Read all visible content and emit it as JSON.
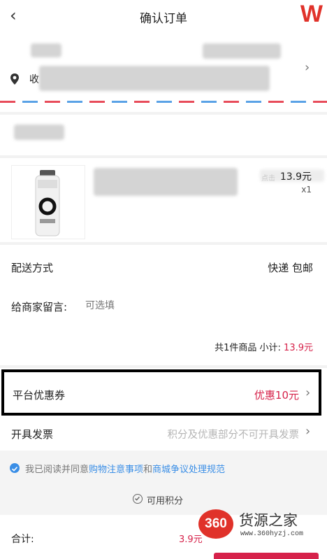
{
  "header": {
    "back_icon": "chevron-left-icon",
    "title": "确认订单",
    "brand_glyph": "W"
  },
  "address": {
    "prefix": "收",
    "pin_icon": "location-pin-icon"
  },
  "product": {
    "price": "13.9元",
    "quantity": "x1",
    "badge": "点击"
  },
  "delivery": {
    "label": "配送方式",
    "value": "快递 包邮"
  },
  "message": {
    "label": "给商家留言:",
    "placeholder": "可选填"
  },
  "subtotal": {
    "text": "共1件商品 小计:",
    "amount": "13.9元"
  },
  "coupon": {
    "label": "平台优惠券",
    "value": "优惠10元"
  },
  "invoice": {
    "label": "开具发票",
    "note": "积分及优惠部分不可开具发票"
  },
  "agreement": {
    "prefix": "我已阅读并同意",
    "link1": "购物注意事项",
    "middle": "和",
    "link2": "商城争议处理规范"
  },
  "points": {
    "label": "可用积分"
  },
  "footer": {
    "total_label": "合计:",
    "total_amount": "3.9元"
  },
  "watermark": {
    "number": "360",
    "name": "货源之家",
    "url": "www.360hyzj.com"
  },
  "colors": {
    "accent_red": "#d6224a",
    "link_blue": "#3a8ee6",
    "brand_red": "#e0322a"
  }
}
